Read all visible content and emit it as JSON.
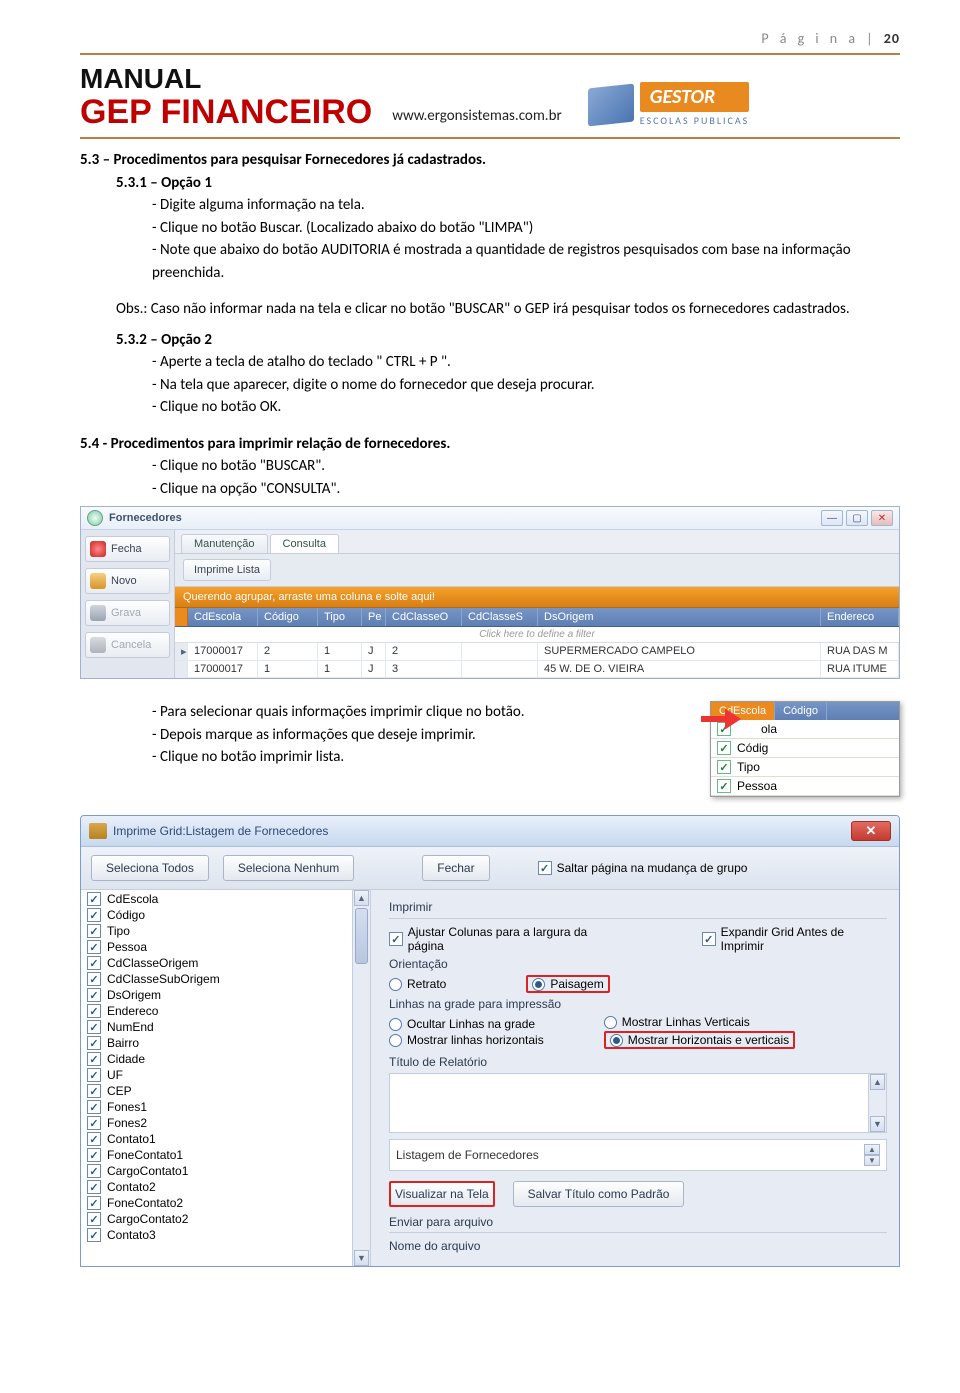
{
  "page_header": {
    "label": "P á g i n a | ",
    "num": "20"
  },
  "brand": {
    "manual": "MANUAL",
    "product": "GEP FINANCEIRO",
    "url": "www.ergonsistemas.com.br",
    "gestor_text": "GESTOR",
    "gestor_sub": "ESCOLAS PUBLICAS"
  },
  "text": {
    "s53": "5.3 – Procedimentos para pesquisar Fornecedores já cadastrados.",
    "s531": "5.3.1 – Opção 1",
    "s531_a": "- Digite alguma informação na tela.",
    "s531_b": "- Clique no botão Buscar. (Localizado abaixo do botão \"LIMPA\")",
    "s531_c": "- Note que abaixo do botão AUDITORIA é mostrada a quantidade de registros pesquisados com base na informação preenchida.",
    "obs": "Obs.: Caso não informar nada na tela e clicar no botão \"BUSCAR\" o GEP irá pesquisar todos os fornecedores cadastrados.",
    "s532": "5.3.2 – Opção 2",
    "s532_a": "- Aperte a tecla de atalho do teclado \" CTRL + P \".",
    "s532_b": "- Na tela que aparecer, digite o nome do fornecedor que deseja procurar.",
    "s532_c": "- Clique no botão OK.",
    "s54": "5.4 - Procedimentos para imprimir relação de fornecedores.",
    "s54_a": "- Clique no botão \"BUSCAR\".",
    "s54_b": "- Clique na opção \"CONSULTA\".",
    "sel_a": "- Para selecionar quais informações imprimir clique no botão.",
    "sel_b": "- Depois marque as informações que deseje imprimir.",
    "sel_c": "- Clique no botão imprimir lista."
  },
  "app1": {
    "title": "Fornecedores",
    "sidebar": {
      "fecha": "Fecha",
      "novo": "Novo",
      "grava": "Grava",
      "cancela": "Cancela"
    },
    "tabs": {
      "manutencao": "Manutenção",
      "consulta": "Consulta"
    },
    "toolbar": {
      "imprime": "Imprime Lista"
    },
    "group_hint": "Querendo agrupar, arraste uma coluna e solte aqui!",
    "cols": {
      "cdescola": "CdEscola",
      "codigo": "Código",
      "tipo": "Tipo",
      "pe": "Pe",
      "cdco": "CdClasseO",
      "cdcs": "CdClasseS",
      "dso": "DsOrigem",
      "end": "Endereco"
    },
    "filter_hint": "Click here to define a filter",
    "rows": [
      {
        "escola": "17000017",
        "codigo": "2",
        "tipo": "1",
        "pe": "J",
        "cdco": "2",
        "cdcs": "",
        "dso": "SUPERMERCADO CAMPELO",
        "end": "RUA DAS M"
      },
      {
        "escola": "17000017",
        "codigo": "1",
        "tipo": "1",
        "pe": "J",
        "cdco": "3",
        "cdcs": "",
        "dso": "45 W. DE O. VIEIRA",
        "end": "RUA ITUME"
      }
    ]
  },
  "col_popup": {
    "head1": "CdEscola",
    "head2": "Código",
    "hidden_hint": "ola",
    "items": [
      "Códig",
      "Tipo",
      "Pessoa"
    ]
  },
  "app2": {
    "title": "Imprime Grid:Listagem de Fornecedores",
    "btn_sel_all": "Seleciona Todos",
    "btn_sel_none": "Seleciona Nenhum",
    "btn_fechar": "Fechar",
    "chk_saltar": "Saltar página na mudança de grupo",
    "left": [
      "CdEscola",
      "Código",
      "Tipo",
      "Pessoa",
      "CdClasseOrigem",
      "CdClasseSubOrigem",
      "DsOrigem",
      "Endereco",
      "NumEnd",
      "Bairro",
      "Cidade",
      "UF",
      "CEP",
      "Fones1",
      "Fones2",
      "Contato1",
      "FoneContato1",
      "CargoContato1",
      "Contato2",
      "FoneContato2",
      "CargoContato2",
      "Contato3"
    ],
    "grp_imprimir": "Imprimir",
    "chk_ajustar": "Ajustar Colunas para a largura da página",
    "chk_expandir": "Expandir Grid Antes de Imprimir",
    "grp_orient": "Orientação",
    "opt_retrato": "Retrato",
    "opt_paisagem": "Paisagem",
    "grp_linhas": "Linhas na grade para impressão",
    "opt_ocultar": "Ocultar Linhas na grade",
    "opt_mostrar_h": "Mostrar linhas horizontais",
    "opt_mostrar_v": "Mostrar Linhas Verticais",
    "opt_mostrar_hv": "Mostrar Horizontais e verticais",
    "grp_titulo": "Título de Relatório",
    "titulo_value": "Listagem de Fornecedores",
    "btn_visualizar": "Visualizar na Tela",
    "btn_salvar_titulo": "Salvar Título como Padrão",
    "grp_enviar": "Enviar para arquivo",
    "lbl_nome_arq": "Nome do arquivo"
  }
}
